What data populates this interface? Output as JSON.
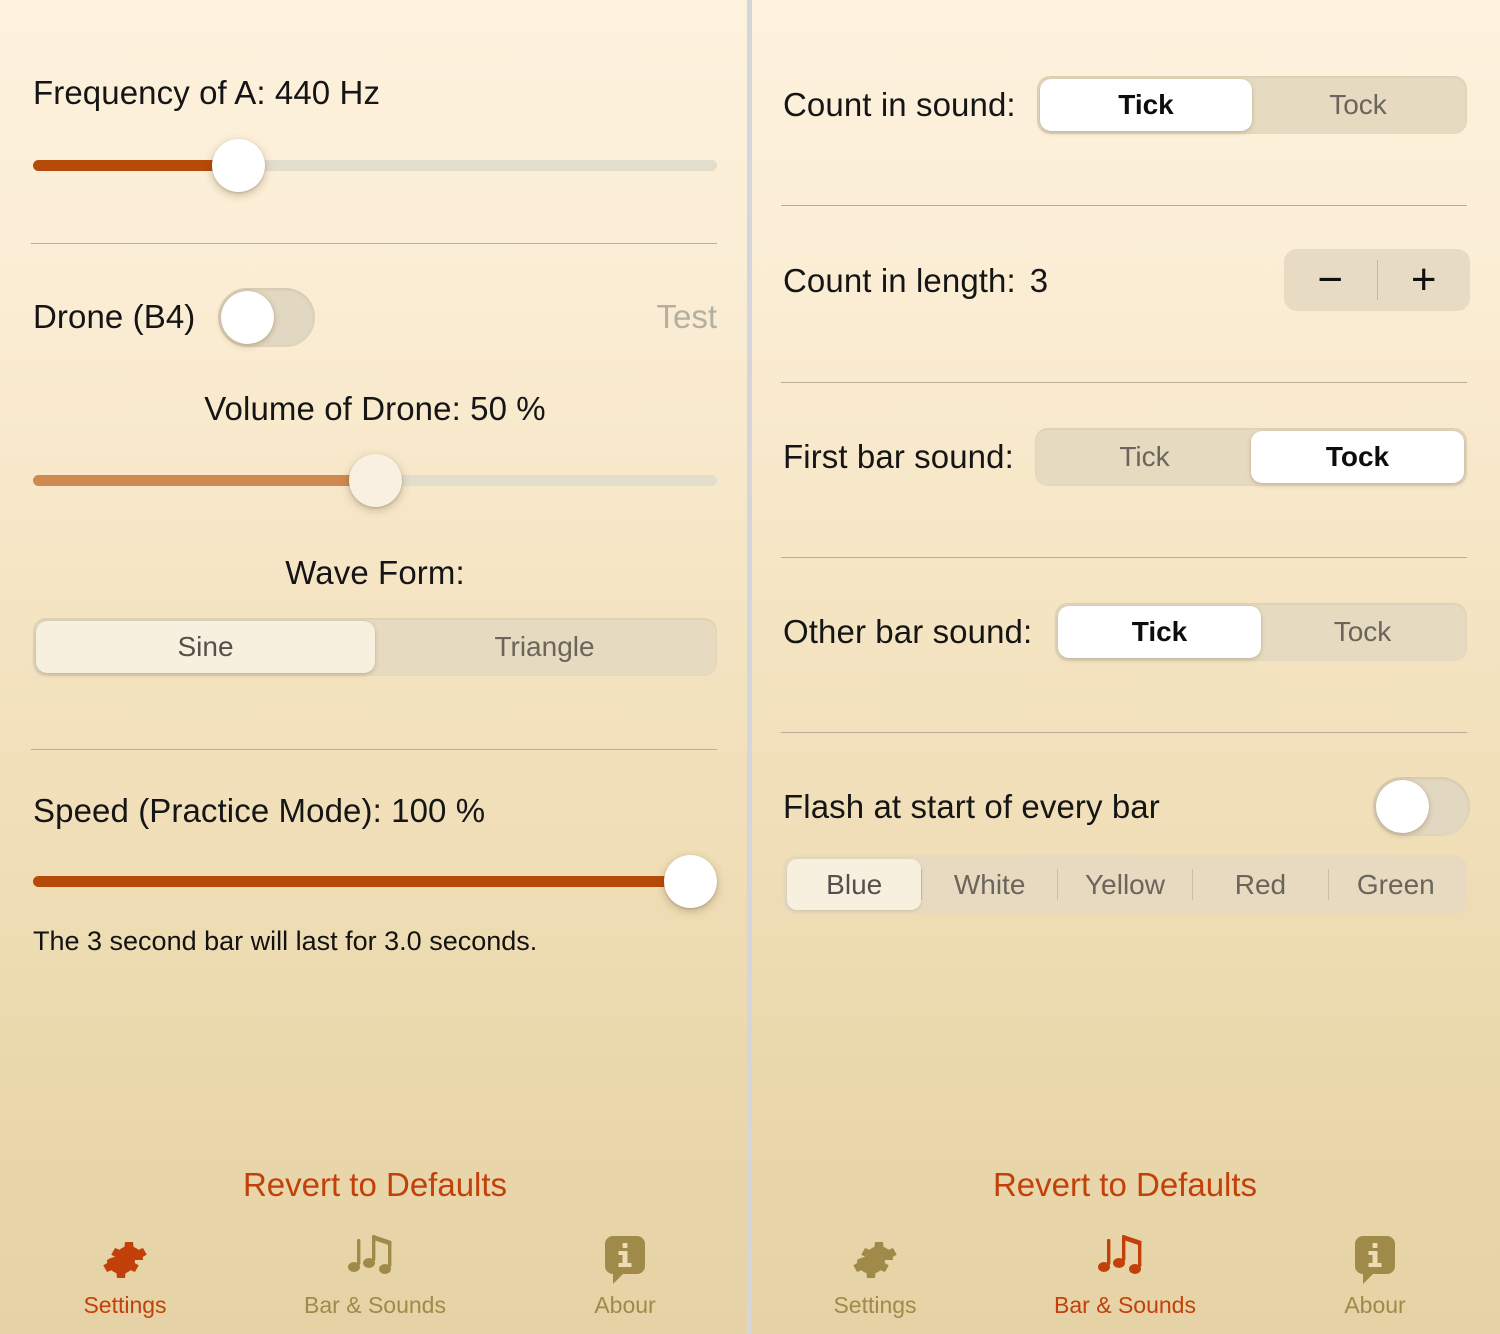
{
  "colors": {
    "accent": "#C2400A",
    "slider_fill_strong": "#B54A09",
    "slider_fill_soft": "#D08950",
    "background_top": "#FDF2DE",
    "background_bottom": "#E5D2A5",
    "track": "#E3DDCC",
    "segment_bg": "#E6DAC0",
    "tab_inactive": "#A08A4A",
    "disabled_text": "#B5AFA0"
  },
  "left_panel": {
    "frequency": {
      "label": "Frequency of A: 440 Hz",
      "value": 440,
      "unit": "Hz",
      "slider_percent": 30
    },
    "drone": {
      "label": "Drone (B4)",
      "toggle_on": false,
      "test_label": "Test",
      "volume_label": "Volume of Drone: 50 %",
      "volume_percent": 50
    },
    "wave_form": {
      "title": "Wave Form:",
      "options": [
        "Sine",
        "Triangle"
      ],
      "selected": "Sine"
    },
    "speed": {
      "label": "Speed (Practice Mode): 100 %",
      "percent": 100,
      "note": "The 3 second bar will last for 3.0 seconds."
    },
    "revert_label": "Revert to Defaults",
    "tabs": [
      {
        "label": "Settings",
        "icon": "gear-icon",
        "active": true
      },
      {
        "label": "Bar & Sounds",
        "icon": "music-notes-icon",
        "active": false
      },
      {
        "label": "Abour",
        "icon": "info-bubble-icon",
        "active": false
      }
    ]
  },
  "right_panel": {
    "count_in_sound": {
      "label": "Count in sound:",
      "options": [
        "Tick",
        "Tock"
      ],
      "selected": "Tick"
    },
    "count_in_length": {
      "label": "Count in length:",
      "value": "3",
      "decrement_label": "−",
      "increment_label": "+"
    },
    "first_bar_sound": {
      "label": "First bar sound:",
      "options": [
        "Tick",
        "Tock"
      ],
      "selected": "Tock"
    },
    "other_bar_sound": {
      "label": "Other bar sound:",
      "options": [
        "Tick",
        "Tock"
      ],
      "selected": "Tick"
    },
    "flash": {
      "label": "Flash at start of every bar",
      "toggle_on": false,
      "colors": [
        "Blue",
        "White",
        "Yellow",
        "Red",
        "Green"
      ],
      "selected": "Blue"
    },
    "revert_label": "Revert to Defaults",
    "tabs": [
      {
        "label": "Settings",
        "icon": "gear-icon",
        "active": false
      },
      {
        "label": "Bar & Sounds",
        "icon": "music-notes-icon",
        "active": true
      },
      {
        "label": "Abour",
        "icon": "info-bubble-icon",
        "active": false
      }
    ]
  }
}
